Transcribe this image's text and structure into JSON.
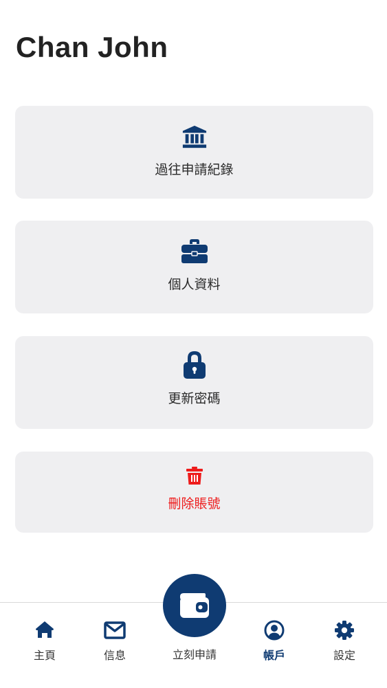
{
  "header": {
    "user_name": "Chan John"
  },
  "menu": {
    "items": [
      {
        "label": "過往申請紀錄",
        "icon": "bank-icon"
      },
      {
        "label": "個人資料",
        "icon": "briefcase-icon"
      },
      {
        "label": "更新密碼",
        "icon": "lock-icon"
      },
      {
        "label": "刪除賬號",
        "icon": "trash-icon"
      }
    ]
  },
  "tabbar": {
    "home_label": "主頁",
    "messages_label": "信息",
    "apply_label": "立刻申請",
    "account_label": "帳戶",
    "settings_label": "設定",
    "active_tab": "帳戶"
  },
  "colors": {
    "primary": "#0f3b72",
    "danger": "#ee1c1c",
    "card_background": "#efeff1"
  }
}
